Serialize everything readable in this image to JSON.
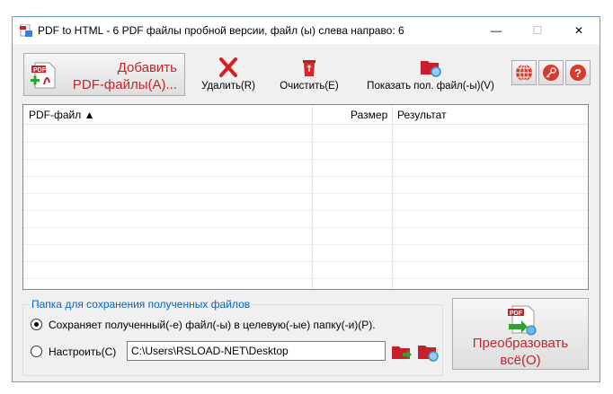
{
  "window": {
    "title": "PDF to HTML - 6 PDF файлы пробной версии, файл (ы) слева направо: 6",
    "minimize_glyph": "—",
    "maximize_glyph": "☐",
    "close_glyph": "✕"
  },
  "toolbar": {
    "add_line1": "Добавить",
    "add_line2": "PDF-файлы(A)...",
    "delete_label": "Удалить(R)",
    "clear_label": "Очистить(E)",
    "show_label": "Показать пол. файл(-ы)(V)",
    "right_icons": [
      "globe-icon",
      "key-icon",
      "help-icon"
    ]
  },
  "file_list": {
    "columns": [
      "PDF-файл ▲",
      "Размер",
      "Результат"
    ],
    "rows": []
  },
  "output": {
    "group_title": "Папка для сохранения полученных файлов",
    "option_target": "Сохраняет полученный(-е) файл(-ы) в целевую(-ые) папку(-и)(P).",
    "option_custom": "Настроить(C)",
    "selected_option": "target",
    "path_value": "C:\\Users\\RSLOAD-NET\\Desktop"
  },
  "convert": {
    "line1": "Преобразовать",
    "line2": "всё(O)"
  },
  "colors": {
    "accent_red": "#c0262c",
    "group_title_blue": "#0066cc",
    "window_border": "#6e9fd8"
  }
}
